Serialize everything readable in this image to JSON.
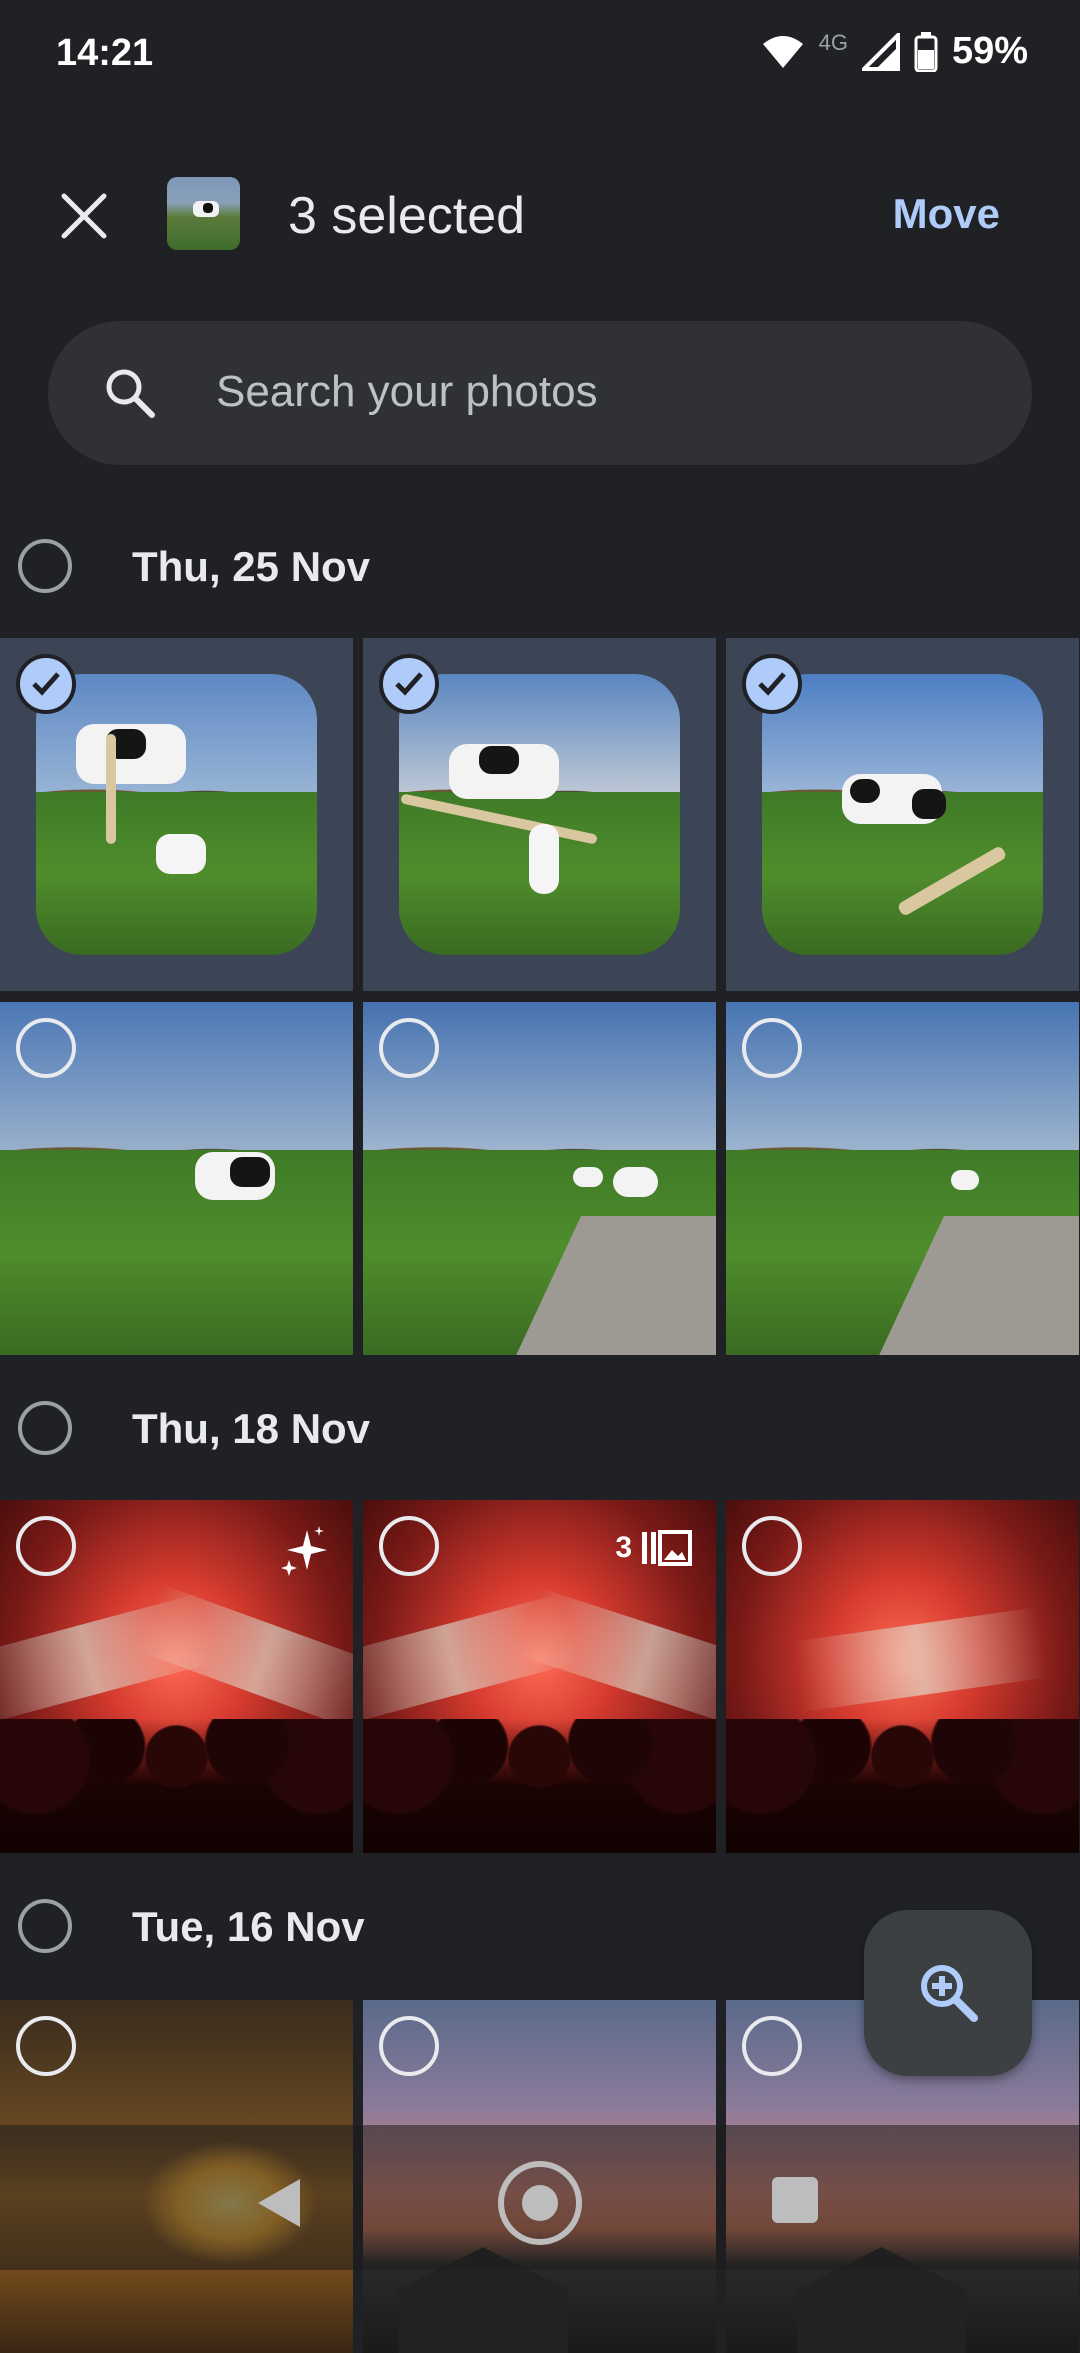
{
  "status_bar": {
    "time": "14:21",
    "network": "4G",
    "battery_pct": "59%"
  },
  "app_bar": {
    "selected_count": "3 selected",
    "move_label": "Move"
  },
  "search": {
    "placeholder": "Search your photos"
  },
  "sections": [
    {
      "date": "Thu, 25 Nov"
    },
    {
      "date": "Thu, 18 Nov"
    },
    {
      "date": "Tue, 16 Nov"
    }
  ],
  "photo_badges": {
    "stack_count": "3"
  },
  "colors": {
    "accent": "#aecbfa",
    "background": "#202124",
    "selected_tile": "#3c4556"
  }
}
